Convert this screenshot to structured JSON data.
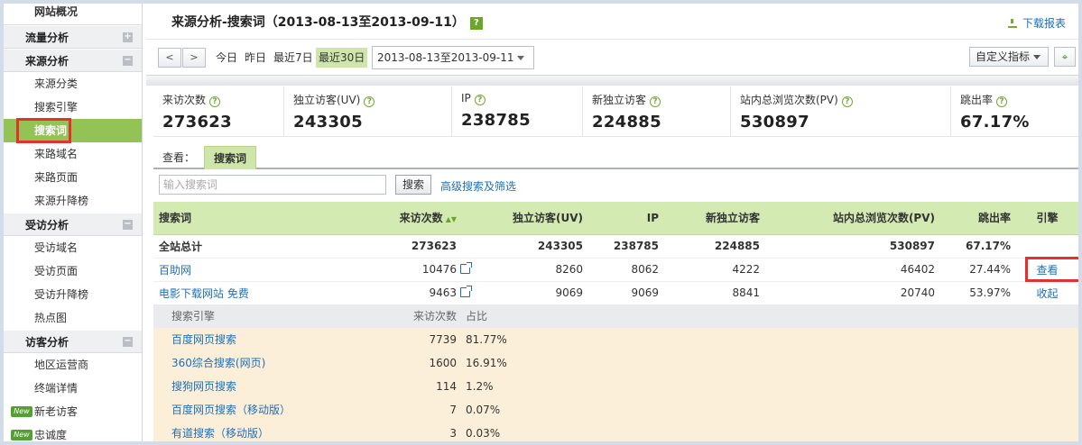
{
  "sidebar": {
    "top_item": "网站概况",
    "groups": [
      {
        "label": "流量分析",
        "toggle": "+",
        "items": []
      },
      {
        "label": "来源分析",
        "toggle": "−",
        "items": [
          "来源分类",
          "搜索引擎",
          "搜索词",
          "来路域名",
          "来路页面",
          "来源升降榜"
        ]
      },
      {
        "label": "受访分析",
        "toggle": "−",
        "items": [
          "受访域名",
          "受访页面",
          "受访升降榜",
          "热点图"
        ]
      },
      {
        "label": "访客分析",
        "toggle": "−",
        "items": [
          "地区运营商",
          "终端详情",
          "新老访客",
          "忠诚度"
        ]
      }
    ],
    "new_badge": "New"
  },
  "header": {
    "title": "来源分析-搜索词（2013-08-13至2013-09-11）",
    "help": "?",
    "download_label": "下载报表"
  },
  "toolbar": {
    "prev": "<",
    "next": ">",
    "today": "今日",
    "yesterday": "昨日",
    "last7": "最近7日",
    "last30": "最近30日",
    "date_range": "2013-08-13至2013-09-11",
    "custom_metrics": "自定义指标"
  },
  "metrics": [
    {
      "label": "来访次数",
      "value": "273623"
    },
    {
      "label": "独立访客(UV)",
      "value": "243305"
    },
    {
      "label": "IP",
      "value": "238785"
    },
    {
      "label": "新独立访客",
      "value": "224885"
    },
    {
      "label": "站内总浏览次数(PV)",
      "value": "530897"
    },
    {
      "label": "跳出率",
      "value": "67.17%"
    }
  ],
  "view": {
    "label": "查看：",
    "tab": "搜索词"
  },
  "search": {
    "placeholder": "输入搜索词",
    "button": "搜索",
    "advanced": "高级搜索及筛选"
  },
  "table": {
    "columns": [
      "搜索词",
      "来访次数",
      "独立访客(UV)",
      "IP",
      "新独立访客",
      "站内总浏览次数(PV)",
      "跳出率",
      "引擎"
    ],
    "total": {
      "keyword": "全站总计",
      "visits": "273623",
      "uv": "243305",
      "ip": "238785",
      "new_uv": "224885",
      "pv": "530897",
      "bounce": "67.17%"
    },
    "rows": [
      {
        "keyword": "百助网",
        "visits": "10476",
        "uv": "8260",
        "ip": "8062",
        "new_uv": "4222",
        "pv": "46402",
        "bounce": "27.44%",
        "action": "查看"
      },
      {
        "keyword": "电影下载网站 免费",
        "visits": "9463",
        "uv": "9069",
        "ip": "9069",
        "new_uv": "8841",
        "pv": "20740",
        "bounce": "53.97%",
        "action": "收起"
      }
    ]
  },
  "sub_table": {
    "headers": [
      "搜索引擎",
      "来访次数",
      "占比"
    ],
    "rows": [
      {
        "engine": "百度网页搜索",
        "count": "7739",
        "pct": "81.77%"
      },
      {
        "engine": "360综合搜索(网页)",
        "count": "1600",
        "pct": "16.91%"
      },
      {
        "engine": "搜狗网页搜索",
        "count": "114",
        "pct": "1.2%"
      },
      {
        "engine": "百度网页搜索（移动版）",
        "count": "7",
        "pct": "0.07%"
      },
      {
        "engine": "有道搜索（移动版）",
        "count": "3",
        "pct": "0.03%"
      }
    ]
  }
}
